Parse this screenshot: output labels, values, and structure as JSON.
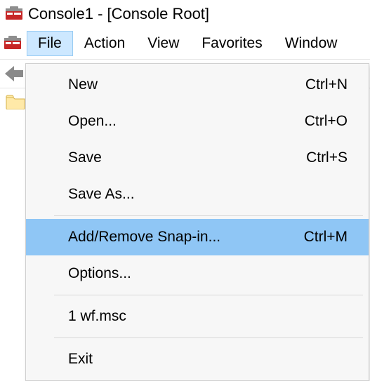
{
  "titlebar": {
    "title": "Console1 - [Console Root]"
  },
  "menubar": {
    "items": [
      "File",
      "Action",
      "View",
      "Favorites",
      "Window"
    ],
    "open_index": 0
  },
  "dropdown": {
    "items": [
      {
        "label": "New",
        "shortcut": "Ctrl+N",
        "sep_after": false,
        "highlight": false
      },
      {
        "label": "Open...",
        "shortcut": "Ctrl+O",
        "sep_after": false,
        "highlight": false
      },
      {
        "label": "Save",
        "shortcut": "Ctrl+S",
        "sep_after": false,
        "highlight": false
      },
      {
        "label": "Save As...",
        "shortcut": "",
        "sep_after": true,
        "highlight": false
      },
      {
        "label": "Add/Remove Snap-in...",
        "shortcut": "Ctrl+M",
        "sep_after": false,
        "highlight": true
      },
      {
        "label": "Options...",
        "shortcut": "",
        "sep_after": true,
        "highlight": false
      },
      {
        "label": "1 wf.msc",
        "shortcut": "",
        "sep_after": true,
        "highlight": false
      },
      {
        "label": "Exit",
        "shortcut": "",
        "sep_after": false,
        "highlight": false
      }
    ]
  }
}
